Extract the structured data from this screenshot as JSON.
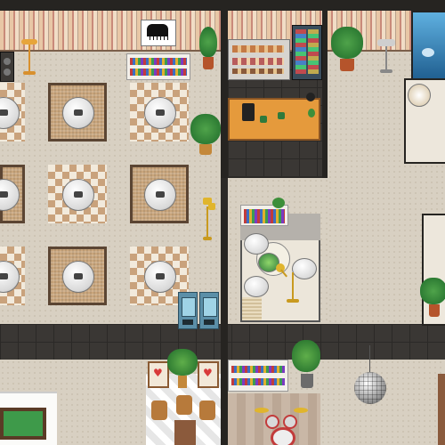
{
  "scene": {
    "title": "",
    "areas": [
      "cafe-seating",
      "kitchen-counter",
      "bar-counter",
      "lounge",
      "art-corner",
      "music-stage",
      "games-room"
    ],
    "colors": {
      "wall_dark": "#262421",
      "floor_tan": "#d8d0c2",
      "floor_dark": "#34312e",
      "table_white": "#f4f4f4",
      "counter_orange": "#e59a3c",
      "aquarium_blue": "#2b7fb8",
      "pool_table_green": "#3e9a4a",
      "easel_heart_red": "#d83a3a"
    },
    "objects": {
      "tables": 9,
      "lounge_chairs": 4,
      "vending_machines": 2,
      "potted_plants": 7,
      "bookshelves": 4
    }
  }
}
